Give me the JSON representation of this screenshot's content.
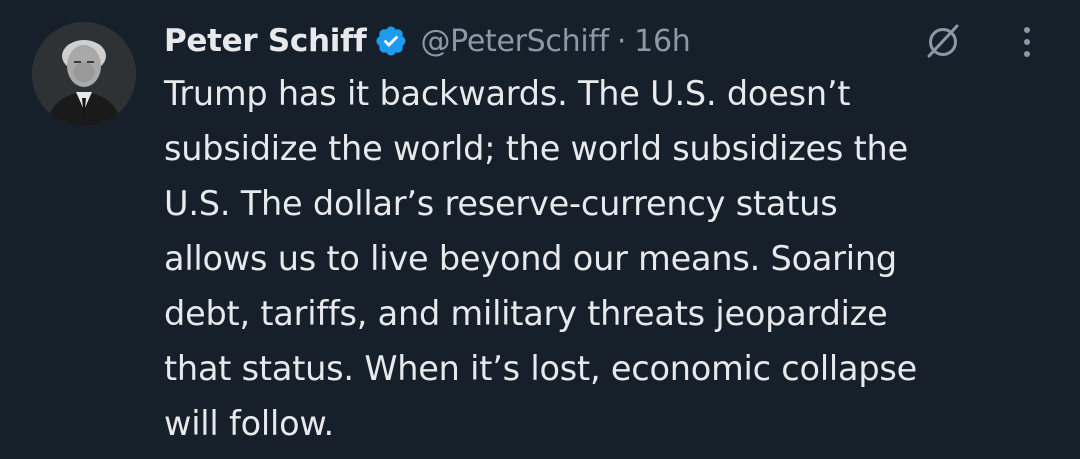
{
  "tweet": {
    "author": {
      "name": "Peter Schiff",
      "handle": "@PeterSchiff",
      "verified": true
    },
    "separator": "·",
    "timestamp": "16h",
    "text_lines": [
      "Trump has it backwards. The U.S. doesn’t",
      "subsidize the world; the world subsidizes the",
      "U.S. The dollar’s reserve-currency status",
      "allows us to live beyond our means. Soaring",
      "debt, tariffs, and military threats jeopardize",
      "that status. When it’s lost, economic collapse",
      "will follow."
    ]
  },
  "icons": {
    "verified": "verified-badge-icon",
    "grok": "grok-icon",
    "more": "more-options-icon"
  },
  "colors": {
    "background": "#15202b",
    "text_primary": "#e7e9ea",
    "text_secondary": "#8b98a5",
    "verified_blue": "#1d9bf0"
  }
}
